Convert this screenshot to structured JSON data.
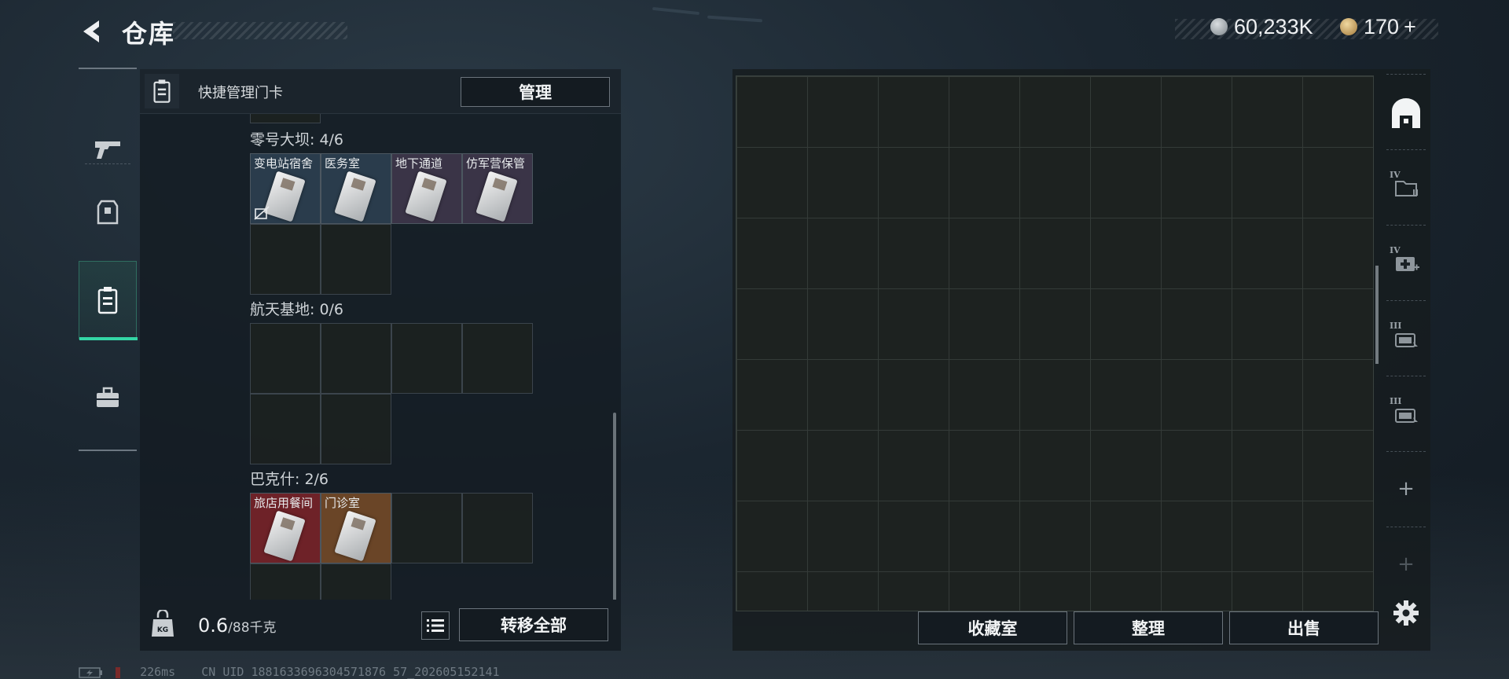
{
  "header": {
    "title": "仓库",
    "currency_silver": "60,233K",
    "currency_gold": "170",
    "gold_add": "+"
  },
  "left_panel": {
    "header_label": "快捷管理门卡",
    "manage_button": "管理",
    "sections": [
      {
        "title": "零号大坝: 4/6",
        "cards": [
          "变电站宿舍",
          "医务室",
          "地下通道",
          "仿军营保管"
        ]
      },
      {
        "title": "航天基地: 0/6",
        "cards": []
      },
      {
        "title": "巴克什: 2/6",
        "cards": [
          "旅店用餐间",
          "门诊室"
        ]
      }
    ],
    "weight_value": "0.6",
    "weight_capacity": "/88千克",
    "weight_icon_text": "KG",
    "transfer_all_button": "转移全部"
  },
  "right_panel": {
    "buttons": [
      "收藏室",
      "整理",
      "出售"
    ],
    "side_levels": [
      "IV",
      "IV",
      "III",
      "III"
    ],
    "add_symbol": "+"
  },
  "status_bar": {
    "latency": "226ms",
    "uid": "CN UID 1881633696304571876 57_202605152141"
  },
  "colors": {
    "accent": "#34d6a6",
    "card_blue": "#2a3c4c",
    "card_purple": "#3a3447",
    "card_red": "#6e2228",
    "card_orange": "#6a4527"
  }
}
